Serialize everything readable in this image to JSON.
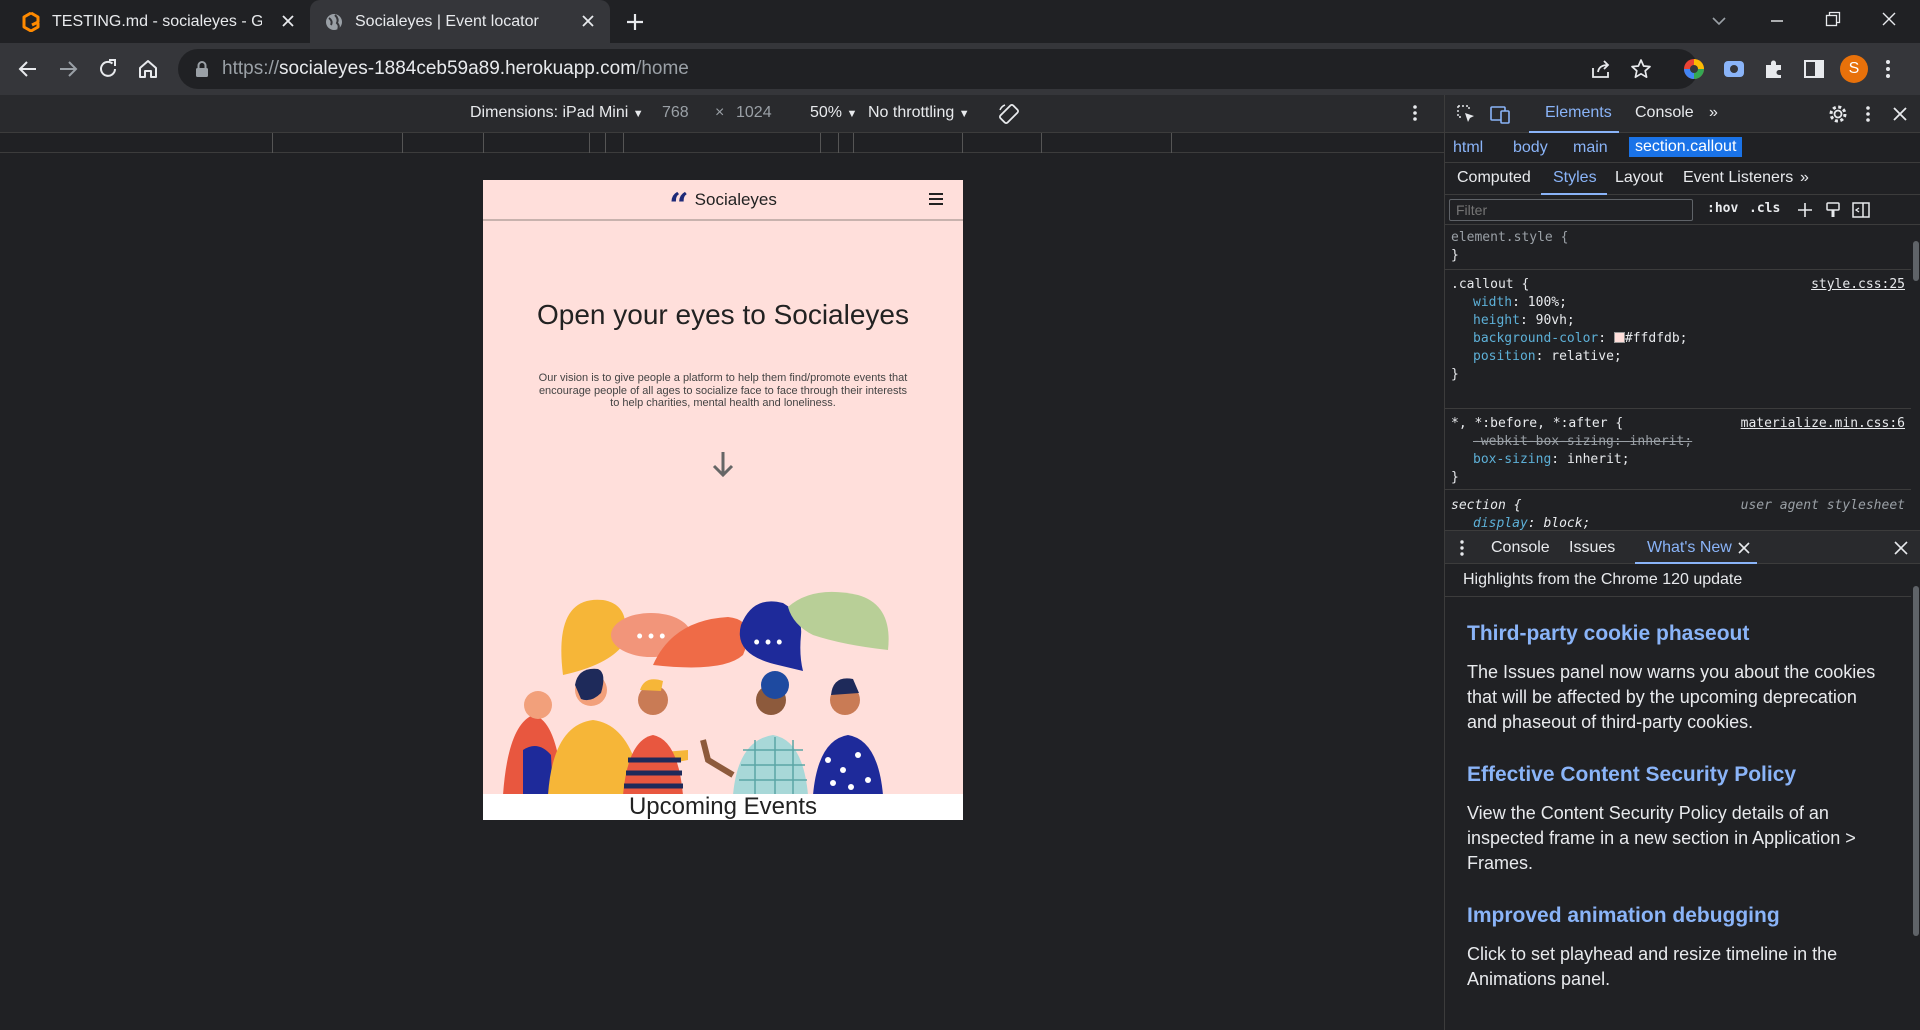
{
  "tabs": [
    {
      "title": "TESTING.md - socialeyes - Gitpo",
      "icon": "gitpod-icon"
    },
    {
      "title": "Socialeyes | Event locator",
      "icon": "globe-icon"
    }
  ],
  "address": {
    "scheme": "https://",
    "host": "socialeyes-1884ceb59a89.herokuapp.com",
    "path": "/home"
  },
  "profile_initial": "S",
  "device_toolbar": {
    "dimensions_label": "Dimensions: iPad Mini",
    "width": "768",
    "times": "×",
    "height": "1024",
    "zoom": "50%",
    "throttling": "No throttling"
  },
  "site": {
    "brand": "Socialeyes",
    "hero_title": "Open your eyes to Socialeyes",
    "hero_text": "Our vision is to give people a platform to help them find/promote events that encourage people of all ages to socialize face to face through their interests to help charities, mental health and loneliness.",
    "next_section": "Upcoming Events",
    "bg_color": "#ffdfdb"
  },
  "devtools": {
    "tabs": [
      "Elements",
      "Console"
    ],
    "breadcrumbs": [
      "html",
      "body",
      "main",
      "section.callout"
    ],
    "subtabs": [
      "Computed",
      "Styles",
      "Layout",
      "Event Listeners"
    ],
    "filter_placeholder": "Filter",
    "hov": ":hov",
    "cls": ".cls",
    "rules": {
      "element_style": "element.style {",
      "close": "}",
      "callout_selector": ".callout {",
      "callout_source": "style.css:25",
      "callout_props": [
        {
          "name": "width",
          "value": "100%;"
        },
        {
          "name": "height",
          "value": "90vh;"
        },
        {
          "name": "background-color",
          "value": "#ffdfdb;"
        },
        {
          "name": "position",
          "value": "relative;"
        }
      ],
      "universal_selector": "*, *:before, *:after {",
      "universal_source": "materialize.min.css:6",
      "universal_props": [
        {
          "name": "-webkit-box-sizing",
          "value": "inherit;"
        },
        {
          "name": "box-sizing",
          "value": "inherit;"
        }
      ],
      "section_selector": "section {",
      "section_source": "user agent stylesheet",
      "section_props": [
        {
          "name": "display",
          "value": "block;"
        }
      ]
    },
    "drawer_tabs": [
      "Console",
      "Issues",
      "What's New"
    ],
    "whats_new": {
      "intro": "Highlights from the Chrome 120 update",
      "items": [
        {
          "title": "Third-party cookie phaseout",
          "text": "The Issues panel now warns you about the cookies that will be affected by the upcoming deprecation and phaseout of third-party cookies."
        },
        {
          "title": "Effective Content Security Policy",
          "text": "View the Content Security Policy details of an inspected frame in a new section in Application > Frames."
        },
        {
          "title": "Improved animation debugging",
          "text": "Click to set playhead and resize timeline in the Animations panel."
        }
      ]
    }
  }
}
